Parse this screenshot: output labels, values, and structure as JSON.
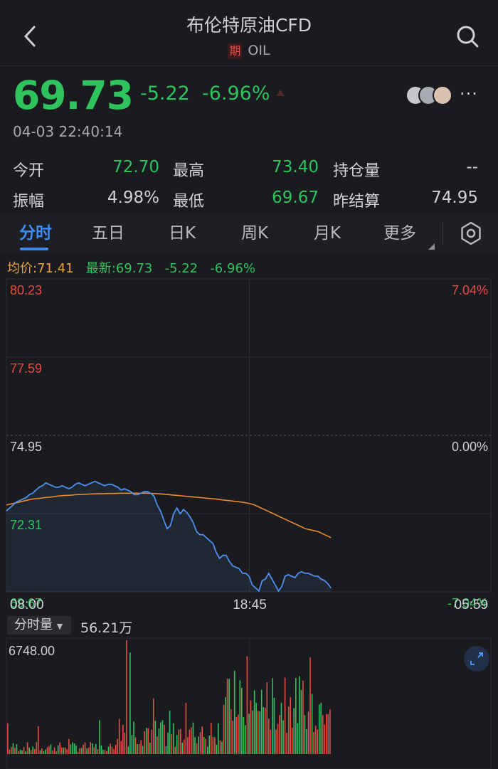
{
  "header": {
    "title": "布伦特原油CFD",
    "badge": "期",
    "symbol": "OIL"
  },
  "quote": {
    "price": "69.73",
    "change": "-5.22",
    "change_pct": "-6.96%",
    "timestamp": "04-03 22:40:14"
  },
  "stats": {
    "open_label": "今开",
    "open_value": "72.70",
    "high_label": "最高",
    "high_value": "73.40",
    "oi_label": "持仓量",
    "oi_value": "--",
    "amp_label": "振幅",
    "amp_value": "4.98%",
    "low_label": "最低",
    "low_value": "69.67",
    "settle_label": "昨结算",
    "settle_value": "74.95"
  },
  "tabs": [
    {
      "label": "分时"
    },
    {
      "label": "五日"
    },
    {
      "label": "日K"
    },
    {
      "label": "周K"
    },
    {
      "label": "月K"
    },
    {
      "label": "更多"
    }
  ],
  "legend": {
    "avg": "均价:71.41",
    "latest": "最新:69.73",
    "change": "-5.22",
    "pct": "-6.96%"
  },
  "volume": {
    "selector_label": "分时量",
    "total": "56.21万",
    "max_label": "6748.00"
  },
  "colors": {
    "up": "#e84b45",
    "down": "#2fc35e",
    "price_line": "#4e8ff0",
    "avg_line": "#e88a2e",
    "accent": "#3d8bf0"
  },
  "chart_data": {
    "type": "line",
    "y_labels_left": [
      "80.23",
      "77.59",
      "74.95",
      "72.31",
      "69.67"
    ],
    "y_labels_right": [
      "7.04%",
      "0.00%",
      "-7.04%"
    ],
    "x_labels": [
      "08:00",
      "18:45",
      "05:59"
    ],
    "ylim": [
      69.67,
      80.23
    ],
    "prev_settle": 74.95,
    "series": [
      {
        "values": [
          72.4,
          72.5,
          72.6,
          72.7,
          72.75,
          72.8,
          72.85,
          72.95,
          73.0,
          73.1,
          73.2,
          73.25,
          73.35,
          73.3,
          73.25,
          73.2,
          73.2,
          73.25,
          73.2,
          73.15,
          73.2,
          73.3,
          73.35,
          73.3,
          73.25,
          73.3,
          73.35,
          73.4,
          73.35,
          73.3,
          73.25,
          73.3,
          73.3,
          73.25,
          73.2,
          73.1,
          73.15,
          73.1,
          73.05,
          72.95,
          72.95,
          73.0,
          73.05,
          73.05,
          73.0,
          72.9,
          72.6,
          72.4,
          72.1,
          71.8,
          71.9,
          72.3,
          72.5,
          72.3,
          72.45,
          72.35,
          72.2,
          72.0,
          71.7,
          71.6,
          71.6,
          71.5,
          71.4,
          71.3,
          71.0,
          70.8,
          70.9,
          70.9,
          70.7,
          70.55,
          70.5,
          70.45,
          70.3,
          70.3,
          70.2,
          69.9,
          69.8,
          69.7,
          70.05,
          70.1,
          70.3,
          70.1,
          69.9,
          69.7,
          69.85,
          70.2,
          70.25,
          70.2,
          70.15,
          70.3,
          70.35,
          70.3,
          70.3,
          70.25,
          70.2,
          70.2,
          70.1,
          70.05,
          69.95,
          69.8
        ],
        "x_end_fraction": 0.67
      },
      {
        "values": [
          72.6,
          72.65,
          72.7,
          72.75,
          72.8,
          72.82,
          72.85,
          72.87,
          72.9,
          72.92,
          72.93,
          72.95,
          72.96,
          72.97,
          72.98,
          72.98,
          72.99,
          72.99,
          73.0,
          73.0,
          73.0,
          73.0,
          73.0,
          72.99,
          72.98,
          72.96,
          72.94,
          72.92,
          72.9,
          72.88,
          72.86,
          72.84,
          72.82,
          72.8,
          72.77,
          72.75,
          72.72,
          72.7,
          72.66,
          72.6,
          72.5,
          72.4,
          72.3,
          72.2,
          72.1,
          72.0,
          71.9,
          71.8,
          71.75,
          71.7,
          71.6,
          71.5
        ],
        "x_end_fraction": 0.67
      }
    ]
  }
}
